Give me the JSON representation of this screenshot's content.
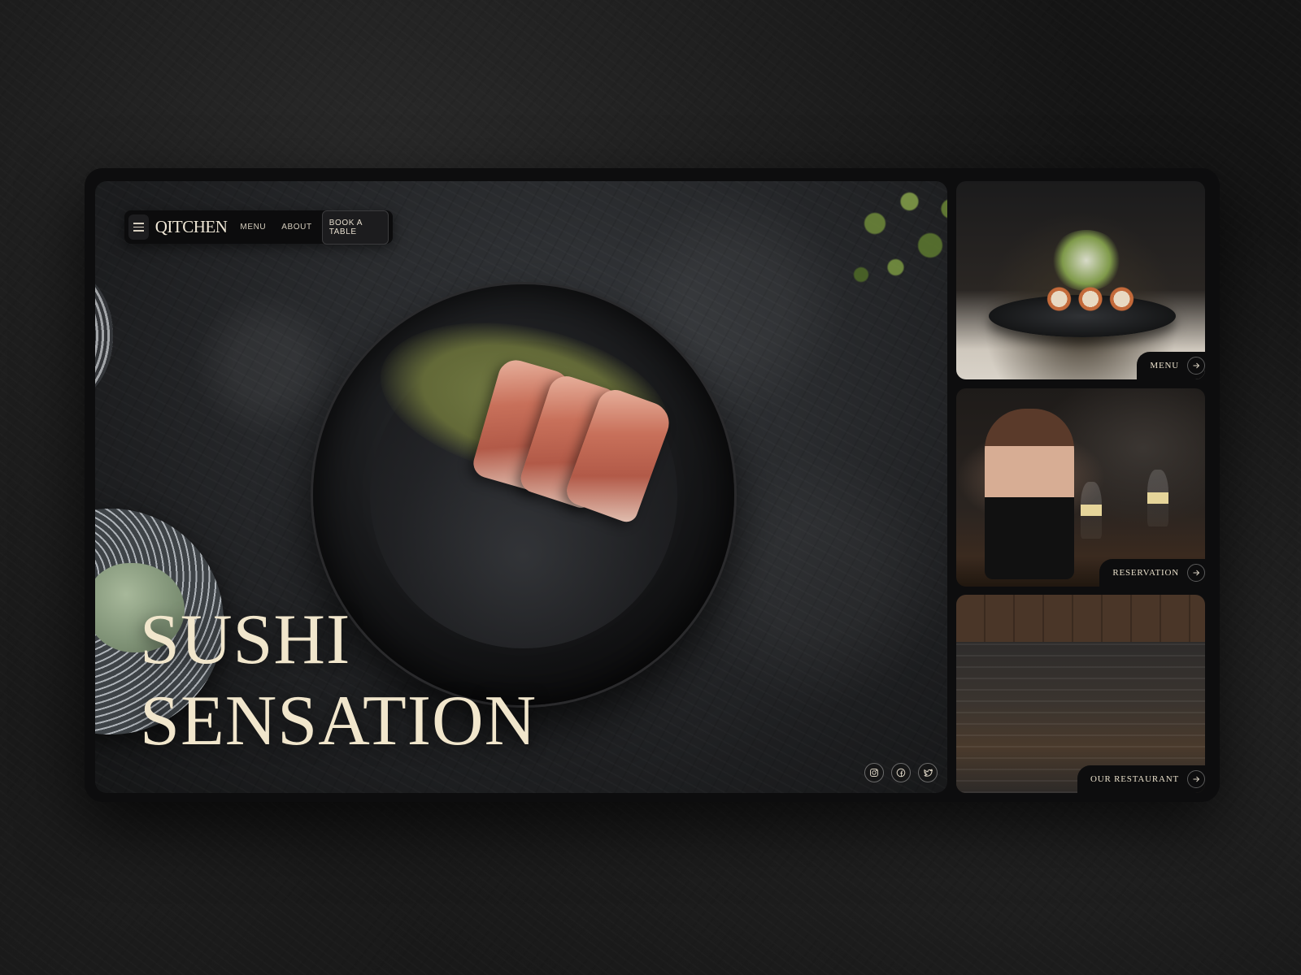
{
  "nav": {
    "logo": "QITCHEN",
    "links": [
      "MENU",
      "ABOUT"
    ],
    "cta": "BOOK A TABLE"
  },
  "hero": {
    "title_line1": "SUSHI",
    "title_line2": "SENSATION"
  },
  "socials": [
    "instagram-icon",
    "facebook-icon",
    "twitter-icon"
  ],
  "cards": [
    {
      "label": "MENU"
    },
    {
      "label": "RESERVATION"
    },
    {
      "label": "OUR RESTAURANT"
    }
  ],
  "colors": {
    "accent_text": "#efe7d6",
    "background": "#151515",
    "panel": "#0d0d0e"
  }
}
